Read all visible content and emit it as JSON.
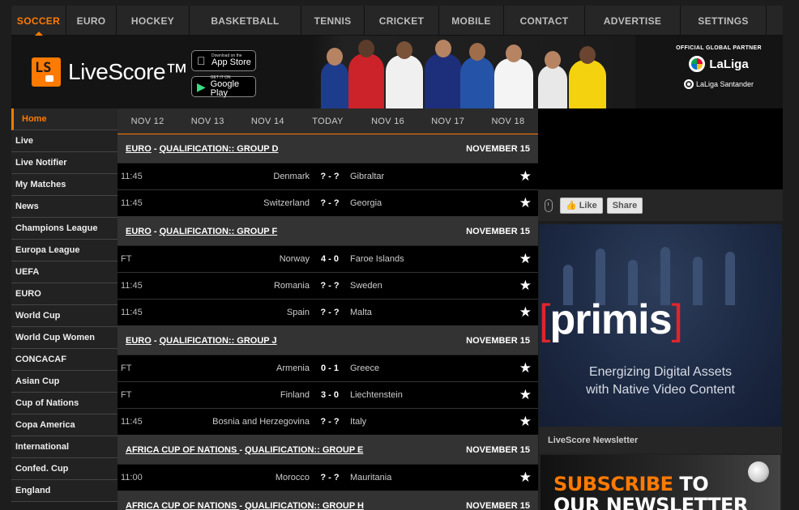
{
  "topnav": [
    "SOCCER",
    "EURO",
    "HOCKEY",
    "BASKETBALL",
    "TENNIS",
    "CRICKET",
    "MOBILE",
    "CONTACT",
    "ADVERTISE",
    "SETTINGS"
  ],
  "header": {
    "logo_mark": "LS",
    "logo_text": "LiveScore™",
    "appstore_small": "Download on the",
    "appstore_big": "App Store",
    "googleplay_small": "GET IT ON",
    "googleplay_big": "Google Play",
    "partner_label": "OFFICIAL GLOBAL PARTNER",
    "partner_name": "LaLiga",
    "partner_sub": "LaLiga Santander"
  },
  "sidebar": [
    "Home",
    "Live",
    "Live Notifier",
    "My Matches",
    "News",
    "Champions League",
    "Europa League",
    "UEFA",
    "EURO",
    "World Cup",
    "World Cup Women",
    "CONCACAF",
    "Asian Cup",
    "Cup of Nations",
    "Copa America",
    "International",
    "Confed. Cup",
    "England"
  ],
  "days": [
    "NOV 12",
    "NOV 13",
    "NOV 14",
    "TODAY",
    "NOV 16",
    "NOV 17",
    "NOV 18"
  ],
  "leagues": [
    {
      "prefix": "EURO",
      "sep": " - ",
      "name": "QUALIFICATION:: GROUP D",
      "date": "NOVEMBER 15",
      "matches": [
        {
          "time": "11:45",
          "home": "Denmark",
          "score": "? - ?",
          "away": "Gibraltar"
        },
        {
          "time": "11:45",
          "home": "Switzerland",
          "score": "? - ?",
          "away": "Georgia"
        }
      ]
    },
    {
      "prefix": "EURO",
      "sep": " - ",
      "name": "QUALIFICATION:: GROUP F",
      "date": "NOVEMBER 15",
      "matches": [
        {
          "time": "FT",
          "home": "Norway",
          "score": "4 - 0",
          "away": "Faroe Islands"
        },
        {
          "time": "11:45",
          "home": "Romania",
          "score": "? - ?",
          "away": "Sweden"
        },
        {
          "time": "11:45",
          "home": "Spain",
          "score": "? - ?",
          "away": "Malta"
        }
      ]
    },
    {
      "prefix": "EURO",
      "sep": " - ",
      "name": "QUALIFICATION:: GROUP J",
      "date": "NOVEMBER 15",
      "matches": [
        {
          "time": "FT",
          "home": "Armenia",
          "score": "0 - 1",
          "away": "Greece"
        },
        {
          "time": "FT",
          "home": "Finland",
          "score": "3 - 0",
          "away": "Liechtenstein"
        },
        {
          "time": "11:45",
          "home": "Bosnia and Herzegovina",
          "score": "? - ?",
          "away": "Italy"
        }
      ]
    },
    {
      "prefix": "AFRICA CUP OF NATIONS ",
      "sep": "- ",
      "name": "QUALIFICATION:: GROUP E",
      "date": "NOVEMBER 15",
      "matches": [
        {
          "time": "11:00",
          "home": "Morocco",
          "score": "? - ?",
          "away": "Mauritania"
        }
      ]
    },
    {
      "prefix": "AFRICA CUP OF NATIONS ",
      "sep": "- ",
      "name": "QUALIFICATION:: GROUP H",
      "date": "NOVEMBER 15",
      "matches": []
    }
  ],
  "social": {
    "like": "Like",
    "share": "Share"
  },
  "ad": {
    "brand": "primis",
    "line1": "Energizing Digital Assets",
    "line2": "with Native Video Content"
  },
  "newsletter": {
    "heading": "LiveScore Newsletter",
    "subscribe": "SUBSCRIBE",
    "to": " TO",
    "line2": "OUR NEWSLETTER"
  },
  "colors": {
    "accent": "#ff7a00",
    "bg": "#1d1d1d",
    "row": "#000000",
    "league_bar": "#333333"
  }
}
